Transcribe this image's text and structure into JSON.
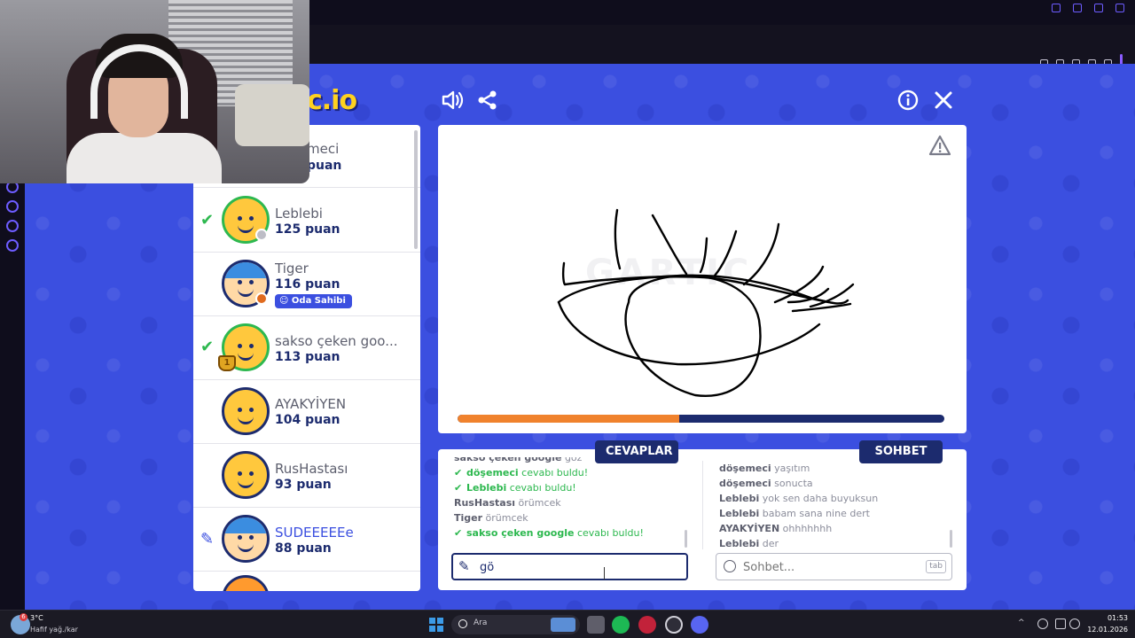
{
  "window": {
    "title": "gartic.io"
  },
  "header": {
    "logo_text": "c.io",
    "sound_icon": "speaker-icon",
    "share_icon": "share-icon",
    "info_icon": "info-icon",
    "close_icon": "close-icon"
  },
  "players": [
    {
      "name": "meci",
      "score": "puan",
      "status": "none"
    },
    {
      "name": "Leblebi",
      "score": "125 puan",
      "status": "guessed"
    },
    {
      "name": "Tiger",
      "score": "116 puan",
      "status": "none",
      "badge": "Oda Sahibi"
    },
    {
      "name": "sakso çeken goo...",
      "score": "113 puan",
      "status": "guessed",
      "trophy": "1"
    },
    {
      "name": "AYAKYİYEN",
      "score": "104 puan",
      "status": "none"
    },
    {
      "name": "RusHastası",
      "score": "93 puan",
      "status": "none"
    },
    {
      "name": "SUDEEEEEe",
      "score": "88 puan",
      "status": "drawing"
    }
  ],
  "canvas": {
    "watermark": "GARTIC",
    "report_icon": "warning-icon",
    "timer_progress": 0.455
  },
  "answers": {
    "tab_label": "CEVAPLAR",
    "messages": [
      {
        "user": "sakso çeken google",
        "text": "göz",
        "found": false
      },
      {
        "user": "döşemeci",
        "text": "cevabı buldu!",
        "found": true
      },
      {
        "user": "Leblebi",
        "text": "cevabı buldu!",
        "found": true
      },
      {
        "user": "RusHastası",
        "text": "örümcek",
        "found": false
      },
      {
        "user": "Tiger",
        "text": "örümcek",
        "found": false
      },
      {
        "user": "sakso çeken google",
        "text": "cevabı buldu!",
        "found": true
      }
    ],
    "input_value": "gö"
  },
  "chat": {
    "tab_label": "SOHBET",
    "messages": [
      {
        "user": "döşemeci",
        "text": "yaşıtım"
      },
      {
        "user": "döşemeci",
        "text": "sonucta"
      },
      {
        "user": "Leblebi",
        "text": "yok sen daha buyuksun"
      },
      {
        "user": "Leblebi",
        "text": "babam sana nine dert"
      },
      {
        "user": "AYAKYİYEN",
        "text": "ohhhhhhh"
      },
      {
        "user": "Leblebi",
        "text": "der"
      }
    ],
    "input_placeholder": "Sohbet...",
    "tab_hint": "tab"
  },
  "taskbar": {
    "temperature": "3°C",
    "weather": "Hafif yağ./kar",
    "weather_badge": "6",
    "search_label": "Ara",
    "time": "01:53",
    "date": "12.01.2026",
    "sidebar_label": "GX"
  },
  "colors": {
    "game_blue": "#3b4fe0",
    "navy": "#1c2b6e",
    "found_green": "#2db84f",
    "timer_orange": "#f0822d"
  }
}
